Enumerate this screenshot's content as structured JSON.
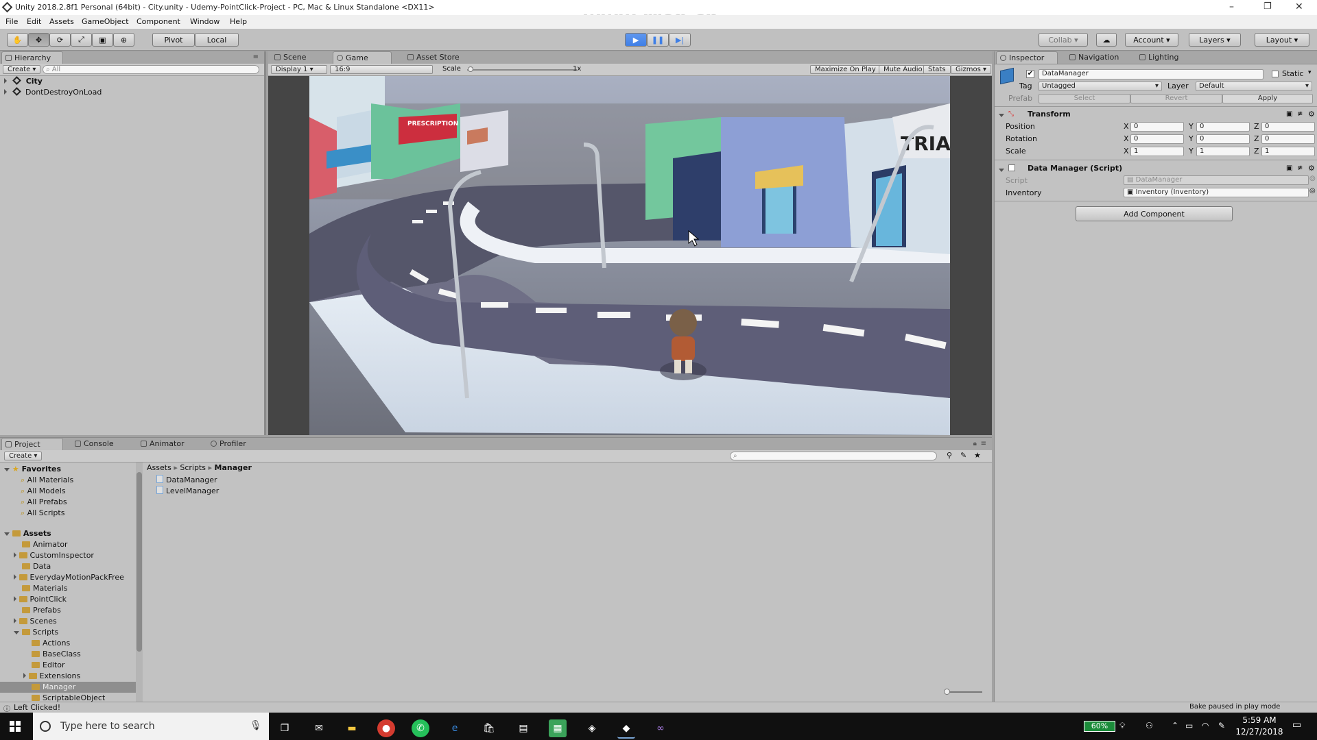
{
  "window": {
    "title": "Unity 2018.2.8f1 Personal (64bit) - City.unity - Udemy-PointClick-Project - PC, Mac & Linux Standalone <DX11>",
    "watermark": "www.rrcg.cn",
    "controls": {
      "minimize": "–",
      "maximize": "❐",
      "close": "✕"
    }
  },
  "menu": [
    "File",
    "Edit",
    "Assets",
    "GameObject",
    "Component",
    "Window",
    "Help"
  ],
  "toolbar": {
    "pivot": "Pivot",
    "local": "Local",
    "collab": "Collab",
    "account": "Account",
    "layers": "Layers",
    "layout": "Layout"
  },
  "hierarchy": {
    "tab": "Hierarchy",
    "create": "Create",
    "search_placeholder": "All",
    "items": [
      "City",
      "DontDestroyOnLoad"
    ]
  },
  "game_view": {
    "tabs": [
      "Scene",
      "Game",
      "Asset Store"
    ],
    "display": "Display 1",
    "aspect": "16:9",
    "scale_label": "Scale",
    "scale_value": "1x",
    "options": [
      "Maximize On Play",
      "Mute Audio",
      "Stats",
      "Gizmos"
    ],
    "sign1": "PRESCRIPTION DRUGS",
    "sign2": "TRIA"
  },
  "inspector": {
    "tabs": [
      "Inspector",
      "Navigation",
      "Lighting"
    ],
    "object_name": "DataManager",
    "static_label": "Static",
    "tag_label": "Tag",
    "tag_value": "Untagged",
    "layer_label": "Layer",
    "layer_value": "Default",
    "prefab_label": "Prefab",
    "prefab_select": "Select",
    "prefab_revert": "Revert",
    "prefab_apply": "Apply",
    "transform_title": "Transform",
    "position_label": "Position",
    "rotation_label": "Rotation",
    "scale_label": "Scale",
    "position": {
      "x": "0",
      "y": "0",
      "z": "0"
    },
    "rotation": {
      "x": "0",
      "y": "0",
      "z": "0"
    },
    "scale": {
      "x": "1",
      "y": "1",
      "z": "1"
    },
    "axis_x": "X",
    "axis_y": "Y",
    "axis_z": "Z",
    "script_component_title": "Data Manager (Script)",
    "script_label": "Script",
    "script_value": "DataManager",
    "inventory_label": "Inventory",
    "inventory_value": "Inventory (Inventory)",
    "add_component": "Add Component"
  },
  "project": {
    "tabs": [
      "Project",
      "Console",
      "Animator",
      "Profiler"
    ],
    "create": "Create",
    "favorites_label": "Favorites",
    "favorites": [
      "All Materials",
      "All Models",
      "All Prefabs",
      "All Scripts"
    ],
    "assets_label": "Assets",
    "folders": [
      "Animator",
      "CustomInspector",
      "Data",
      "EverydayMotionPackFree",
      "Materials",
      "PointClick",
      "Prefabs",
      "Scenes",
      "Scripts"
    ],
    "script_subfolders": [
      "Actions",
      "BaseClass",
      "Editor",
      "Extensions",
      "Manager",
      "ScriptableObject"
    ],
    "breadcrumb": [
      "Assets",
      "Scripts",
      "Manager"
    ],
    "files": [
      "DataManager",
      "LevelManager"
    ]
  },
  "status": {
    "left": "Left Clicked!",
    "right": "Bake paused in play mode"
  },
  "taskbar": {
    "search_placeholder": "Type here to search",
    "battery": "60%",
    "time": "5:59 AM",
    "date": "12/27/2018"
  },
  "colors": {
    "play_blue": "#3f7fe6",
    "selected_blue": "#3d7bd8",
    "taskbar": "#101010",
    "editor_bg": "#c2c2c2"
  }
}
